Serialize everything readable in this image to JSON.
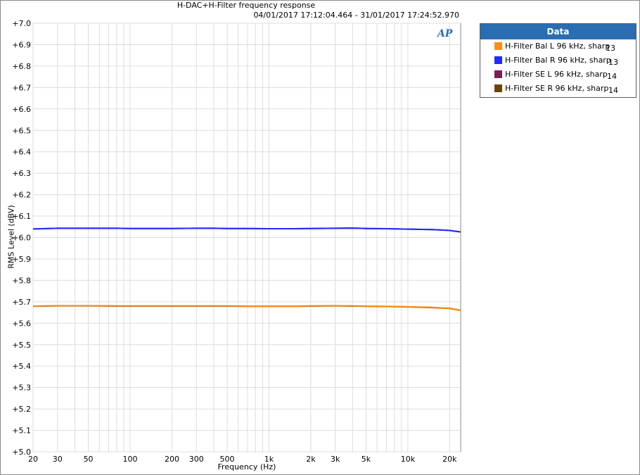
{
  "chart_data": {
    "type": "line",
    "title": "H-DAC+H-Filter frequency response",
    "subtitle": "04/01/2017 17:12:04.464 - 31/01/2017 17:24:52.970",
    "xlabel": "Frequency (Hz)",
    "ylabel": "RMS Level (dBV)",
    "x_scale": "log",
    "xlim": [
      20,
      24000
    ],
    "ylim": [
      5.0,
      7.0
    ],
    "grid": true,
    "legend_title": "Data",
    "legend_position": "right",
    "x_ticks": [
      {
        "value": 20,
        "label": "20"
      },
      {
        "value": 30,
        "label": "30"
      },
      {
        "value": 50,
        "label": "50"
      },
      {
        "value": 100,
        "label": "100"
      },
      {
        "value": 200,
        "label": "200"
      },
      {
        "value": 300,
        "label": "300"
      },
      {
        "value": 500,
        "label": "500"
      },
      {
        "value": 1000,
        "label": "1k"
      },
      {
        "value": 2000,
        "label": "2k"
      },
      {
        "value": 3000,
        "label": "3k"
      },
      {
        "value": 5000,
        "label": "5k"
      },
      {
        "value": 10000,
        "label": "10k"
      },
      {
        "value": 20000,
        "label": "20k"
      }
    ],
    "y_ticks": [
      {
        "value": 5.0,
        "label": "+5.0"
      },
      {
        "value": 5.1,
        "label": "+5.1"
      },
      {
        "value": 5.2,
        "label": "+5.2"
      },
      {
        "value": 5.3,
        "label": "+5.3"
      },
      {
        "value": 5.4,
        "label": "+5.4"
      },
      {
        "value": 5.5,
        "label": "+5.5"
      },
      {
        "value": 5.6,
        "label": "+5.6"
      },
      {
        "value": 5.7,
        "label": "+5.7"
      },
      {
        "value": 5.8,
        "label": "+5.8"
      },
      {
        "value": 5.9,
        "label": "+5.9"
      },
      {
        "value": 6.0,
        "label": "+6.0"
      },
      {
        "value": 6.1,
        "label": "+6.1"
      },
      {
        "value": 6.2,
        "label": "+6.2"
      },
      {
        "value": 6.3,
        "label": "+6.3"
      },
      {
        "value": 6.4,
        "label": "+6.4"
      },
      {
        "value": 6.5,
        "label": "+6.5"
      },
      {
        "value": 6.6,
        "label": "+6.6"
      },
      {
        "value": 6.7,
        "label": "+6.7"
      },
      {
        "value": 6.8,
        "label": "+6.8"
      },
      {
        "value": 6.9,
        "label": "+6.9"
      },
      {
        "value": 7.0,
        "label": "+7.0"
      }
    ],
    "x": [
      20,
      30,
      50,
      80,
      100,
      150,
      200,
      300,
      400,
      500,
      700,
      1000,
      1500,
      2000,
      3000,
      4000,
      5000,
      7000,
      10000,
      15000,
      20000,
      24000
    ],
    "series": [
      {
        "name": "H-Filter Bal L 96 kHz, sharp",
        "count": "13",
        "color": "#ff8c1a",
        "values": [
          5.68,
          5.682,
          5.682,
          5.681,
          5.681,
          5.681,
          5.681,
          5.681,
          5.681,
          5.681,
          5.68,
          5.68,
          5.68,
          5.681,
          5.682,
          5.681,
          5.68,
          5.679,
          5.677,
          5.674,
          5.67,
          5.661
        ]
      },
      {
        "name": "H-Filter Bal R 96 kHz, sharp",
        "count": "13",
        "color": "#1f2bff",
        "values": [
          6.04,
          6.043,
          6.043,
          6.043,
          6.042,
          6.042,
          6.042,
          6.043,
          6.043,
          6.042,
          6.042,
          6.041,
          6.041,
          6.042,
          6.043,
          6.044,
          6.042,
          6.041,
          6.039,
          6.037,
          6.033,
          6.026
        ]
      },
      {
        "name": "H-Filter SE L 96 kHz, sharp",
        "count": "14",
        "color": "#7a1f55",
        "values": [
          6.04,
          6.043,
          6.043,
          6.043,
          6.042,
          6.042,
          6.042,
          6.043,
          6.043,
          6.042,
          6.042,
          6.041,
          6.041,
          6.042,
          6.043,
          6.044,
          6.042,
          6.041,
          6.039,
          6.037,
          6.033,
          6.026
        ]
      },
      {
        "name": "H-Filter SE R 96 kHz, sharp",
        "count": "14",
        "color": "#6b4400",
        "values": [
          5.679,
          5.681,
          5.681,
          5.68,
          5.68,
          5.68,
          5.68,
          5.68,
          5.68,
          5.68,
          5.679,
          5.679,
          5.679,
          5.68,
          5.681,
          5.68,
          5.679,
          5.678,
          5.676,
          5.673,
          5.669,
          5.66
        ]
      }
    ],
    "line_order": [
      3,
      0,
      2,
      1
    ]
  }
}
